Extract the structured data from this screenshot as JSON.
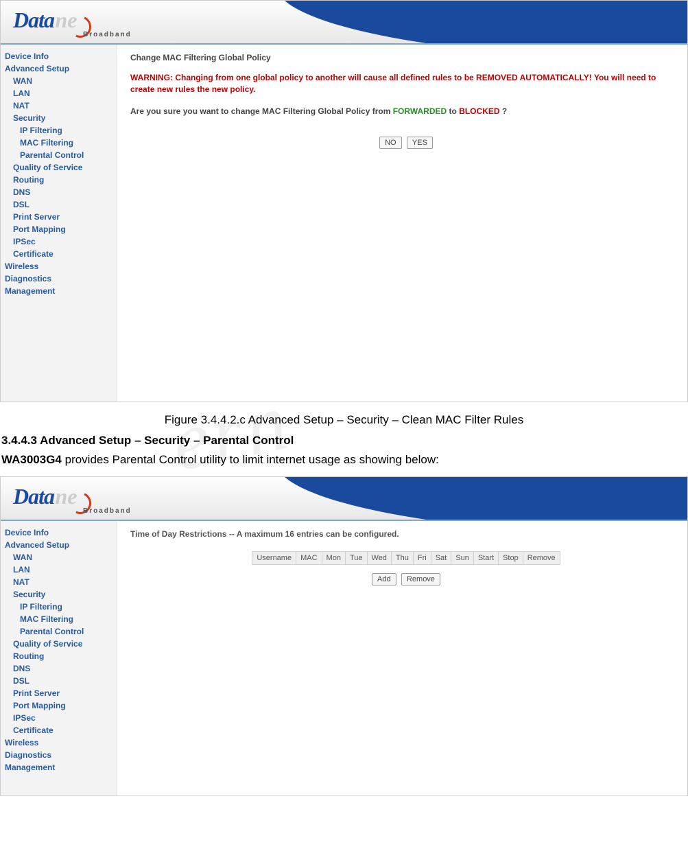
{
  "logo": {
    "primary": "Data",
    "secondary": "ne",
    "sub": "Broadband"
  },
  "sidebar": {
    "top": [
      "Device Info",
      "Advanced Setup"
    ],
    "adv": [
      "WAN",
      "LAN",
      "NAT",
      "Security"
    ],
    "sec": [
      "IP Filtering",
      "MAC Filtering",
      "Parental Control"
    ],
    "adv2": [
      "Quality of Service",
      "Routing",
      "DNS",
      "DSL",
      "Print Server",
      "Port Mapping",
      "IPSec",
      "Certificate"
    ],
    "bottom": [
      "Wireless",
      "Diagnostics",
      "Management"
    ]
  },
  "panel1": {
    "title": "Change MAC Filtering Global Policy",
    "warning": "WARNING: Changing from one global policy to another will cause all defined rules to be REMOVED AUTOMATICALLY! You will need to create new rules the new policy.",
    "question_pre": "Are you sure you want to change MAC Filtering Global Policy from ",
    "from": "FORWARDED",
    "mid": " to ",
    "to": "BLOCKED",
    "question_post": " ?",
    "btn_no": "NO",
    "btn_yes": "YES"
  },
  "doc": {
    "caption1": "Figure 3.4.4.2.c Advanced Setup – Security – Clean MAC Filter Rules",
    "heading": "3.4.4.3 Advanced Setup – Security – Parental Control",
    "para_bold": "WA3003G4",
    "para_rest": " provides Parental Control utility to limit internet usage as showing below:"
  },
  "panel2": {
    "title": "Time of Day Restrictions -- A maximum 16 entries can be configured.",
    "cols": [
      "Username",
      "MAC",
      "Mon",
      "Tue",
      "Wed",
      "Thu",
      "Fri",
      "Sat",
      "Sun",
      "Start",
      "Stop",
      "Remove"
    ],
    "btn_add": "Add",
    "btn_remove": "Remove"
  },
  "watermark": "ern"
}
